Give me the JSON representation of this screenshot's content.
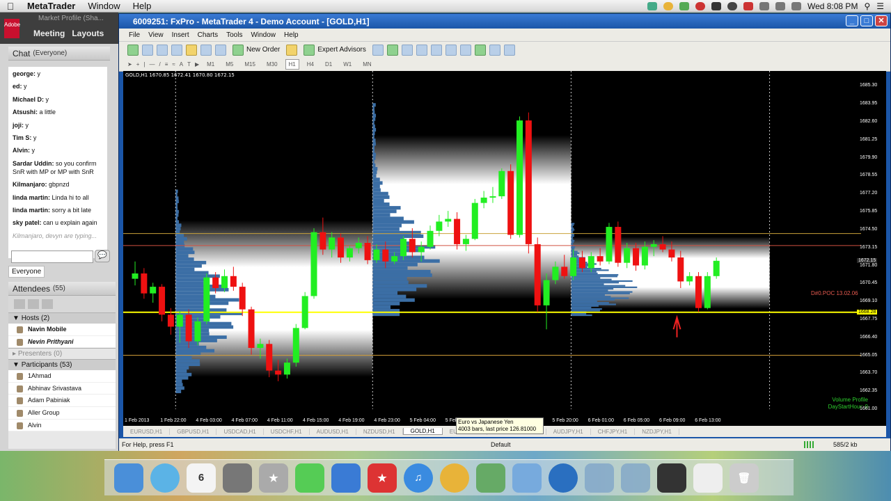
{
  "mac_menubar": {
    "app": "MetaTrader",
    "menus": [
      "Window",
      "Help"
    ],
    "clock": "Wed 8:08 PM",
    "colors": {
      "accent": "#1b56a8"
    }
  },
  "connect": {
    "window_title": "Market Profile (Sha...",
    "logo": "Adobe",
    "tabs": [
      "Meeting",
      "Layouts"
    ],
    "chat_title": "Chat",
    "chat_scope": "(Everyone)",
    "messages": [
      {
        "who": "george:",
        "text": "y"
      },
      {
        "who": "ed:",
        "text": "y"
      },
      {
        "who": "Michael D:",
        "text": "y"
      },
      {
        "who": "Atsushi:",
        "text": "a little"
      },
      {
        "who": "joji:",
        "text": "y"
      },
      {
        "who": "Tim S:",
        "text": "y"
      },
      {
        "who": "Alvin:",
        "text": "y"
      },
      {
        "who": "Sardar Uddin:",
        "text": "so you confirm SnR with MP or MP with SnR"
      },
      {
        "who": "Kilmanjaro:",
        "text": "gbpnzd"
      },
      {
        "who": "linda martin:",
        "text": "Linda hi to all"
      },
      {
        "who": "linda martin:",
        "text": "sorry a bit late"
      },
      {
        "who": "sky patel:",
        "text": "can u explain again"
      }
    ],
    "typing": "Kilmanjaro, devyn are typing...",
    "chat_target": "Everyone",
    "attendees_title": "Attendees",
    "attendees_count": "(55)",
    "hosts_label": "Hosts (2)",
    "hosts": [
      "Navin Mobile",
      "Nevin Prithyani"
    ],
    "presenters_label": "Presenters (0)",
    "participants_label": "Participants (53)",
    "participants": [
      "1Ahmad",
      "Abhinav Srivastava",
      "Adam Pabiniak",
      "Aller Group",
      "Alvin"
    ]
  },
  "mt4": {
    "title": "6009251: FxPro - MetaTrader 4 - Demo Account - [GOLD,H1]",
    "menu": [
      "File",
      "View",
      "Insert",
      "Charts",
      "Tools",
      "Window",
      "Help"
    ],
    "new_order": "New Order",
    "expert_advisors": "Expert Advisors",
    "timeframes": [
      "M1",
      "M5",
      "M15",
      "M30",
      "H1",
      "H4",
      "D1",
      "W1",
      "MN"
    ],
    "selected_timeframe": "H1",
    "chart_info": "GOLD,H1  1670.85 1672.41 1670.80 1672.15",
    "poc_label": "D#0.POC 13.02.06",
    "vp_label": "Volume Profile",
    "vp_sub": "DayStartHour: 0",
    "tabs": [
      "EURUSD,H1",
      "GBPUSD,H1",
      "USDCAD,H1",
      "USDCHF,H1",
      "AUDUSD,H1",
      "NZDUSD,H1",
      "GOLD,H1",
      "EURJPY,H1",
      "",
      "GBPJPY,H1",
      "AUDJPY,H1",
      "CHFJPY,H1",
      "NZDJPY,H1"
    ],
    "active_tab": "GOLD,H1",
    "tooltip_line1": "Euro vs Japanese Yen",
    "tooltip_line2": "4003 bars, last price 126.81000",
    "status_help": "For Help, press F1",
    "status_profile": "Default",
    "status_traffic": "585/2 kb"
  },
  "chart_data": {
    "type": "candlestick",
    "symbol": "GOLD,H1",
    "price_ticks": [
      "1685.30",
      "1683.95",
      "1682.60",
      "1681.25",
      "1679.90",
      "1678.55",
      "1677.20",
      "1675.85",
      "1674.50",
      "1673.15",
      "1671.80",
      "1670.45",
      "1669.10",
      "1667.75",
      "1666.40",
      "1665.05",
      "1663.70",
      "1662.35",
      "1661.00"
    ],
    "last_price_label": "1672.15",
    "line_price_label": "1668.28",
    "time_ticks": [
      "1 Feb 2013",
      "1 Feb 22:00",
      "4 Feb 03:00",
      "4 Feb 07:00",
      "4 Feb 11:00",
      "4 Feb 15:00",
      "4 Feb 19:00",
      "4 Feb 23:00",
      "5 Feb 04:00",
      "5 Feb 08:00",
      "5 Feb 12:00",
      "5 Feb 16:00",
      "5 Feb 20:00",
      "6 Feb 01:00",
      "6 Feb 05:00",
      "6 Feb 09:00",
      "6 Feb 13:00"
    ],
    "candles": [
      [
        1670.8,
        1672.1,
        1670.3,
        1671.2
      ],
      [
        1671.2,
        1671.6,
        1669.3,
        1669.7
      ],
      [
        1669.7,
        1670.5,
        1669.0,
        1670.2
      ],
      [
        1670.2,
        1670.4,
        1667.6,
        1668.1
      ],
      [
        1668.1,
        1668.6,
        1666.6,
        1667.2
      ],
      [
        1667.2,
        1668.4,
        1666.0,
        1668.1
      ],
      [
        1668.1,
        1668.5,
        1665.6,
        1666.1
      ],
      [
        1666.1,
        1667.9,
        1665.8,
        1667.6
      ],
      [
        1667.6,
        1671.2,
        1667.4,
        1670.9
      ],
      [
        1670.9,
        1671.3,
        1669.7,
        1670.1
      ],
      [
        1670.1,
        1671.5,
        1669.8,
        1671.0
      ],
      [
        1671.0,
        1671.7,
        1669.9,
        1670.2
      ],
      [
        1670.2,
        1670.5,
        1668.0,
        1668.5
      ],
      [
        1668.5,
        1668.7,
        1665.1,
        1665.6
      ],
      [
        1665.6,
        1666.3,
        1664.8,
        1665.9
      ],
      [
        1665.9,
        1666.2,
        1663.4,
        1663.9
      ],
      [
        1663.9,
        1664.7,
        1663.1,
        1663.6
      ],
      [
        1663.6,
        1664.8,
        1663.3,
        1664.5
      ],
      [
        1664.5,
        1667.4,
        1664.2,
        1667.1
      ],
      [
        1667.1,
        1669.8,
        1667.0,
        1669.5
      ],
      [
        1669.5,
        1674.6,
        1669.3,
        1674.3
      ],
      [
        1674.3,
        1675.4,
        1672.6,
        1673.0
      ],
      [
        1673.0,
        1674.3,
        1672.4,
        1673.9
      ],
      [
        1673.9,
        1674.2,
        1672.0,
        1672.4
      ],
      [
        1672.4,
        1673.3,
        1672.1,
        1673.1
      ],
      [
        1673.1,
        1673.9,
        1672.7,
        1673.5
      ],
      [
        1673.5,
        1674.0,
        1671.9,
        1672.2
      ],
      [
        1672.2,
        1673.4,
        1672.0,
        1673.0
      ],
      [
        1673.0,
        1673.6,
        1671.6,
        1672.1
      ],
      [
        1672.1,
        1672.8,
        1671.9,
        1672.5
      ],
      [
        1672.5,
        1674.0,
        1672.2,
        1673.8
      ],
      [
        1673.8,
        1674.6,
        1672.4,
        1672.8
      ],
      [
        1672.8,
        1673.6,
        1672.1,
        1673.2
      ],
      [
        1673.2,
        1674.8,
        1673.0,
        1674.4
      ],
      [
        1674.4,
        1675.6,
        1674.0,
        1675.1
      ],
      [
        1675.1,
        1675.9,
        1674.7,
        1675.3
      ],
      [
        1675.3,
        1675.8,
        1673.0,
        1673.4
      ],
      [
        1673.4,
        1674.1,
        1672.9,
        1673.8
      ],
      [
        1673.8,
        1676.8,
        1673.7,
        1676.5
      ],
      [
        1676.5,
        1677.4,
        1676.1,
        1676.9
      ],
      [
        1676.9,
        1677.7,
        1676.5,
        1677.0
      ],
      [
        1677.0,
        1679.1,
        1676.8,
        1678.9
      ],
      [
        1678.9,
        1679.4,
        1673.8,
        1674.1
      ],
      [
        1674.1,
        1683.0,
        1673.9,
        1682.7
      ],
      [
        1682.7,
        1683.3,
        1672.7,
        1673.4
      ],
      [
        1673.4,
        1673.9,
        1668.3,
        1668.8
      ],
      [
        1668.8,
        1671.2,
        1667.0,
        1670.7
      ],
      [
        1670.7,
        1672.1,
        1670.4,
        1671.7
      ],
      [
        1671.7,
        1672.6,
        1670.8,
        1671.0
      ],
      [
        1671.0,
        1673.0,
        1670.7,
        1672.4
      ],
      [
        1672.4,
        1672.9,
        1671.3,
        1671.6
      ],
      [
        1671.6,
        1672.8,
        1671.3,
        1672.5
      ],
      [
        1672.5,
        1673.1,
        1671.8,
        1672.1
      ],
      [
        1672.1,
        1675.0,
        1671.9,
        1674.7
      ],
      [
        1674.7,
        1675.1,
        1671.7,
        1672.0
      ],
      [
        1672.0,
        1673.5,
        1671.6,
        1673.1
      ],
      [
        1673.1,
        1673.5,
        1671.4,
        1671.8
      ],
      [
        1671.8,
        1673.6,
        1671.5,
        1673.2
      ],
      [
        1673.2,
        1673.7,
        1672.5,
        1673.4
      ],
      [
        1673.4,
        1674.0,
        1672.8,
        1673.0
      ],
      [
        1673.0,
        1673.6,
        1672.1,
        1672.4
      ],
      [
        1672.4,
        1672.9,
        1670.1,
        1670.6
      ],
      [
        1670.6,
        1671.3,
        1670.3,
        1671.0
      ],
      [
        1671.0,
        1671.3,
        1668.3,
        1668.6
      ],
      [
        1668.6,
        1671.3,
        1668.5,
        1671.0
      ],
      [
        1671.0,
        1672.4,
        1670.8,
        1672.15
      ]
    ],
    "levels": [
      {
        "price": 1668.28,
        "color": "#ffff00"
      },
      {
        "price": 1665.05,
        "color": "#d8a23a"
      },
      {
        "price": 1673.3,
        "color": "#d05040"
      },
      {
        "price": 1674.2,
        "color": "#c9a23a"
      }
    ],
    "profile_sessions": [
      {
        "x0": 0.071,
        "x1": 0.338,
        "low": 1662.2,
        "high": 1677.5,
        "poc": 1668.28
      },
      {
        "x0": 0.338,
        "x1": 0.607,
        "low": 1668.0,
        "high": 1684.0,
        "poc": 1672.0
      },
      {
        "x0": 0.607,
        "x1": 0.876,
        "low": 1668.0,
        "high": 1675.0,
        "poc": 1670.0
      }
    ],
    "ylim": [
      1661.0,
      1686.0
    ],
    "colors": {
      "bull": "#22ee22",
      "bear": "#ee1111",
      "profile": "#3b6ea5",
      "value_area": "#ffffff",
      "background": "#000000"
    }
  }
}
